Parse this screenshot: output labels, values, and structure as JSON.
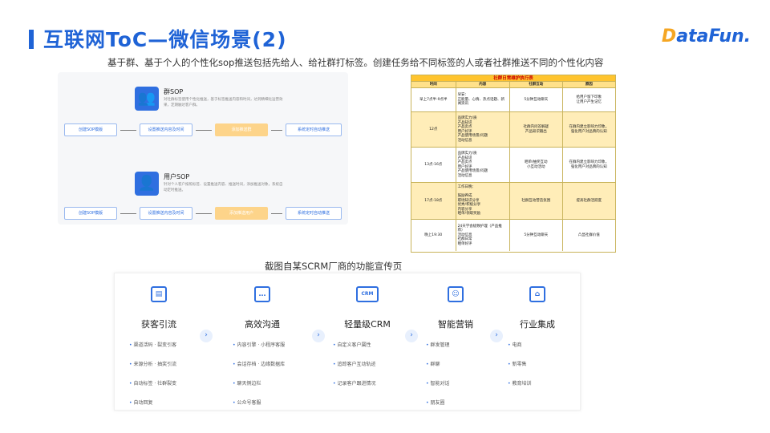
{
  "header": {
    "title": "互联网ToC—微信场景(2)",
    "logo_icon": "dots-logo-icon",
    "logo_text_d": "D",
    "logo_text_rest": "ataFun."
  },
  "subtitle": "基于群、基于个人的个性化sop推送包括先给人、给社群打标签。创建任务给不同标签的人或者社群推送不同的个性化内容",
  "sop": {
    "group": {
      "title": "群SOP",
      "desc": "对社群标签使用个性化推送，基于标签推送内容和时间，达到精细化运营效果，定期触达客户群。",
      "flow": [
        "创建SOP模版",
        "设置推送内容及时间",
        "添加推送群",
        "系统定时自动推送"
      ]
    },
    "user": {
      "title": "用户SOP",
      "desc": "针对个人客户按照标签、设置推送内容、推送时间，添加推送对象，系统自动定时推送。",
      "flow": [
        "创建SOP模版",
        "设置推送内容及时间",
        "添加推送用户",
        "系统定时自动推送"
      ]
    }
  },
  "table": {
    "title": "社群日常维护执行表",
    "columns": [
      "时间",
      "内容",
      "社群互动",
      "原因"
    ],
    "rows": [
      {
        "time": "早上7点半-9点半",
        "content": "早安：\n正能量、心情、热点话题、新闻资讯",
        "interact": "5分钟互动聊天",
        "reason": "给用户留下印象\n让用户产生记忆"
      },
      {
        "time": "12点",
        "content": "品牌实力/质\n产品知识\n产品卖点\n用户好评\n产品使用场景/问题\n活动信息",
        "interact": "社群内问答解疑\n产品知识输出",
        "reason": "在群内建立影响力印象，\n强化用户对品牌的认知"
      },
      {
        "time": "13点-16点",
        "content": "品牌实力/质\n产品知识\n产品卖点\n用户好评\n产品使用场景/问题\n活动信息",
        "interact": "晒单/抽奖互动\n小互动活动",
        "reason": "在群内建立影响力印象，\n强化用户对品牌的认知"
      },
      {
        "time": "17点-18点",
        "content": "工作日晚：\n\n鼓励养成\n职场知识分享\n优秀/积极分享\n内容分享\n晒单/领取奖励",
        "interact": "社群互动营造氛围",
        "reason": "提高社群活跃度"
      },
      {
        "time": "晚上19:30",
        "content": "24天学会极致护理（产品推荐）\n活动信息\n社群日常\n晒单好评",
        "interact": "5分钟互动聊天",
        "reason": "凸显社群价值"
      }
    ]
  },
  "caption": "截图自某SCRM厂商的功能宣传页",
  "features": [
    {
      "icon": "phone-icon",
      "glyph": "▤",
      "title": "获客引流",
      "items": [
        "渠道活码 · 裂变引客",
        "来源分析 · 抽奖引流",
        "自动标签 · 社群裂变",
        "自动回复"
      ]
    },
    {
      "icon": "chat-icon",
      "glyph": "…",
      "title": "高效沟通",
      "items": [
        "内容引擎 · 小程序客服",
        "会话存档 · 边缘数据库",
        "聊天侧边栏",
        "公众号客服"
      ]
    },
    {
      "icon": "crm-icon",
      "glyph": "CRM",
      "title": "轻量级CRM",
      "items": [
        "自定义客户属性",
        "追踪客户互动轨迹",
        "记录客户跟进情况"
      ]
    },
    {
      "icon": "robot-icon",
      "glyph": "☺",
      "title": "智能营销",
      "items": [
        "群发管理",
        "群聊",
        "智能对话",
        "朋友圈"
      ]
    },
    {
      "icon": "building-icon",
      "glyph": "⌂",
      "title": "行业集成",
      "items": [
        "电商",
        "新零售",
        "教育培训"
      ]
    }
  ]
}
